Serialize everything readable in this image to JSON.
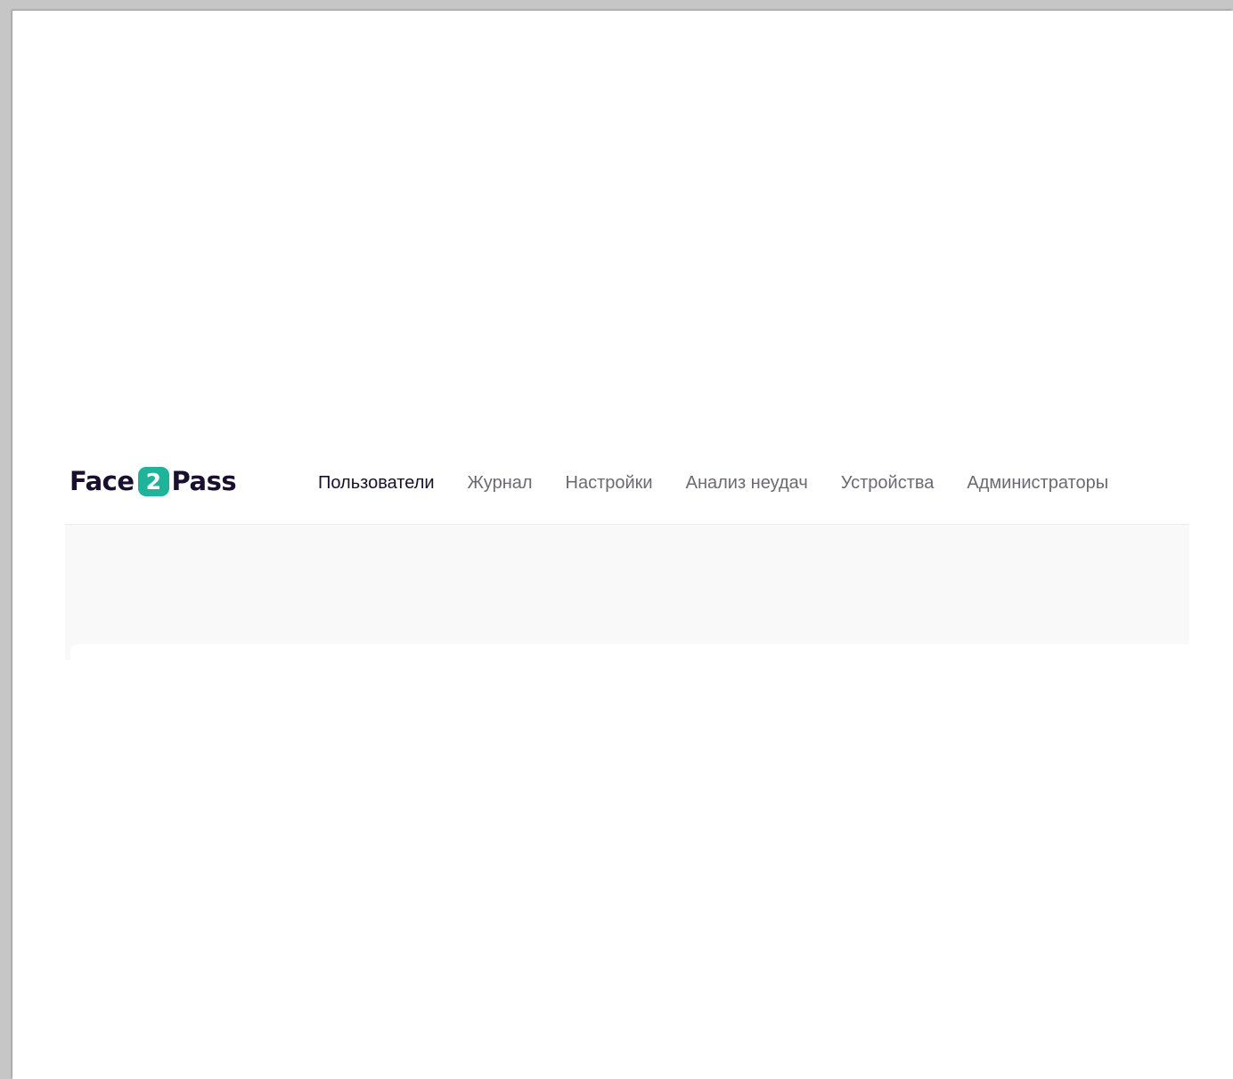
{
  "logo": {
    "left_text": "Face",
    "badge_text": "2",
    "right_text": "Pass"
  },
  "nav": {
    "items": [
      {
        "label": "Пользователи",
        "active": true
      },
      {
        "label": "Журнал",
        "active": false
      },
      {
        "label": "Настройки",
        "active": false
      },
      {
        "label": "Анализ неудач",
        "active": false
      },
      {
        "label": "Устройства",
        "active": false
      },
      {
        "label": "Администраторы",
        "active": false
      }
    ]
  },
  "colors": {
    "brand_dark": "#1a0f2e",
    "brand_accent": "#1fb39a",
    "nav_inactive": "#6d6873",
    "content_bg": "#f9f9f9"
  }
}
